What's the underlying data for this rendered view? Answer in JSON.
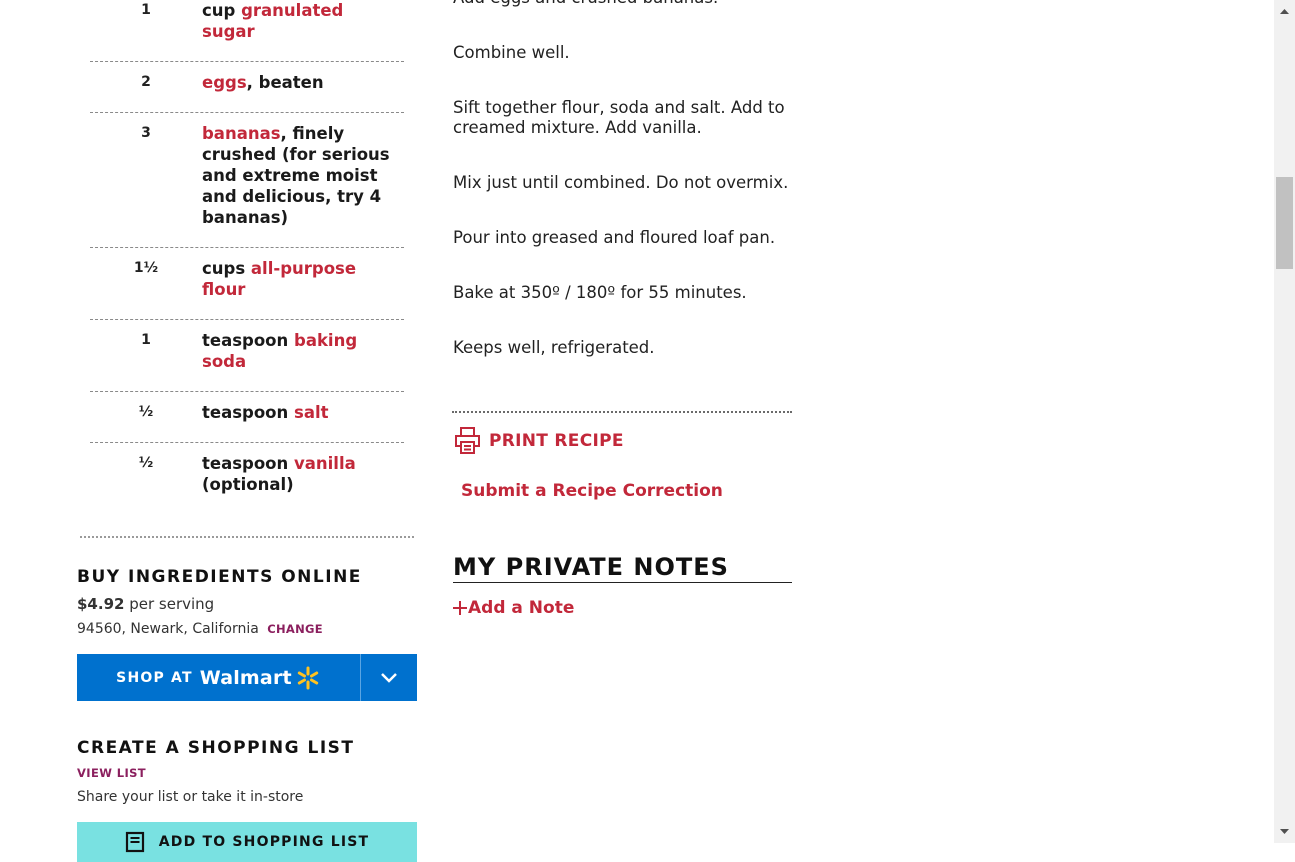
{
  "ingredients": [
    {
      "qty": "1",
      "parts": [
        {
          "t": "cup "
        },
        {
          "t": "granulated sugar",
          "link": true
        }
      ]
    },
    {
      "qty": "2",
      "parts": [
        {
          "t": "eggs",
          "link": true
        },
        {
          "t": ", beaten"
        }
      ]
    },
    {
      "qty": "3",
      "parts": [
        {
          "t": "bananas",
          "link": true
        },
        {
          "t": ", finely crushed (for serious and extreme moist and delicious, try 4 bananas)"
        }
      ]
    },
    {
      "qty": "1½",
      "parts": [
        {
          "t": "cups "
        },
        {
          "t": "all-purpose flour",
          "link": true
        }
      ]
    },
    {
      "qty": "1",
      "parts": [
        {
          "t": "teaspoon "
        },
        {
          "t": "baking soda",
          "link": true
        }
      ]
    },
    {
      "qty": "½",
      "parts": [
        {
          "t": "teaspoon "
        },
        {
          "t": "salt",
          "link": true
        }
      ]
    },
    {
      "qty": "½",
      "parts": [
        {
          "t": "teaspoon "
        },
        {
          "t": "vanilla",
          "link": true
        },
        {
          "t": " (optional)"
        }
      ]
    }
  ],
  "buy": {
    "title": "BUY INGREDIENTS ONLINE",
    "price": "$4.92",
    "per_serving": " per serving",
    "location": "94560, Newark, California",
    "change": "CHANGE",
    "shop_at": "SHOP AT",
    "store": "Walmart"
  },
  "shopping_list": {
    "title": "CREATE A SHOPPING LIST",
    "view_list": "VIEW LIST",
    "share": "Share your list or take it in-store",
    "add_button": "ADD TO SHOPPING LIST"
  },
  "directions": [
    "Add eggs and crushed bananas.",
    "Combine well.",
    "Sift together flour, soda and salt. Add to creamed mixture. Add vanilla.",
    "Mix just until combined. Do not overmix.",
    "Pour into greased and floured loaf pan.",
    "Bake at 350º / 180º for 55 minutes.",
    "Keeps well, refrigerated."
  ],
  "actions": {
    "print": "PRINT RECIPE",
    "correction": "Submit a Recipe Correction"
  },
  "notes": {
    "title": "MY PRIVATE NOTES",
    "add": "Add a Note"
  },
  "colors": {
    "accent": "#c2283a",
    "walmart_blue": "#0071ce",
    "walmart_yellow": "#ffc220",
    "list_button": "#79e1e1",
    "secondary_link": "#8b1f5e"
  },
  "icons": [
    "printer-icon",
    "plus-icon",
    "walmart-spark-icon",
    "chevron-down-icon",
    "list-icon",
    "scroll-up-arrow-icon",
    "scroll-down-arrow-icon"
  ]
}
